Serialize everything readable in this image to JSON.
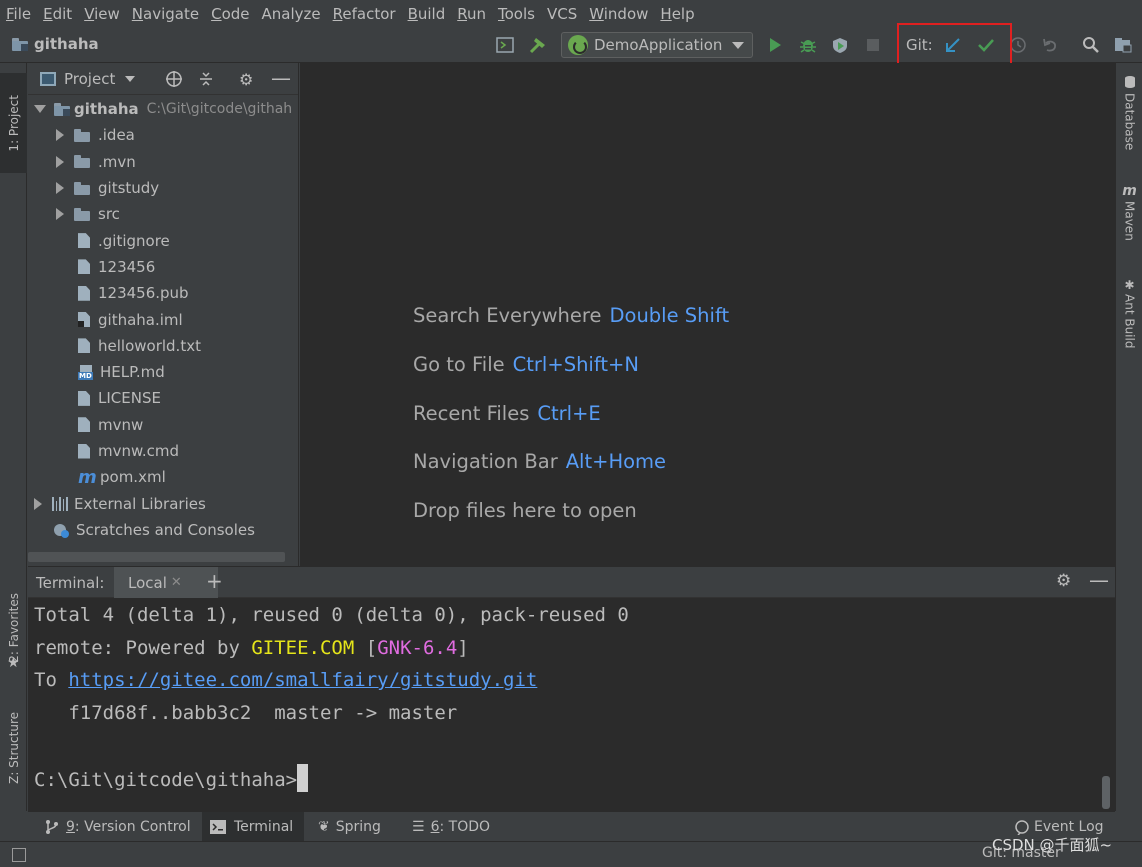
{
  "menu": {
    "items": [
      {
        "u": "F",
        "rest": "ile"
      },
      {
        "u": "E",
        "rest": "dit"
      },
      {
        "u": "V",
        "rest": "iew"
      },
      {
        "u": "N",
        "rest": "avigate"
      },
      {
        "u": "C",
        "rest": "ode"
      },
      {
        "u": "",
        "rest": "Analyze"
      },
      {
        "u": "R",
        "rest": "efactor"
      },
      {
        "u": "B",
        "rest": "uild"
      },
      {
        "u": "R",
        "rest": "un"
      },
      {
        "u": "T",
        "rest": "ools"
      },
      {
        "u": "",
        "rest": "VCS"
      },
      {
        "u": "W",
        "rest": "indow"
      },
      {
        "u": "H",
        "rest": "elp"
      }
    ]
  },
  "navbar": {
    "project_name": "githaha",
    "run_config": "DemoApplication",
    "git_label": "Git:"
  },
  "left_strip": {
    "project_tab": "1: Project",
    "favorites_tab": "2: Favorites",
    "structure_tab": "Z: Structure"
  },
  "right_strip": {
    "database_tab": "Database",
    "maven_tab": "Maven",
    "ant_tab": "Ant Build"
  },
  "project_panel": {
    "title": "Project",
    "root": {
      "name": "githaha",
      "path": "C:\\Git\\gitcode\\githah"
    },
    "folders": [
      ".idea",
      ".mvn",
      "gitstudy",
      "src"
    ],
    "files": [
      ".gitignore",
      "123456",
      "123456.pub",
      "githaha.iml",
      "helloworld.txt",
      "HELP.md",
      "LICENSE",
      "mvnw",
      "mvnw.cmd",
      "pom.xml"
    ],
    "external_libraries": "External Libraries",
    "scratches": "Scratches and Consoles"
  },
  "editor_hints": [
    {
      "text": "Search Everywhere",
      "key": "Double Shift"
    },
    {
      "text": "Go to File",
      "key": "Ctrl+Shift+N"
    },
    {
      "text": "Recent Files",
      "key": "Ctrl+E"
    },
    {
      "text": "Navigation Bar",
      "key": "Alt+Home"
    },
    {
      "text": "Drop files here to open",
      "key": ""
    }
  ],
  "terminal": {
    "title": "Terminal:",
    "tab_label": "Local",
    "line1": "Total 4 (delta 1), reused 0 (delta 0), pack-reused 0",
    "line2_pre": "remote: Powered by ",
    "line2_gitee": "GITEE.COM",
    "line2_mid": " [",
    "line2_gnk": "GNK-6.4",
    "line2_end": "]",
    "line3_pre": "To ",
    "line3_url": "https://gitee.com/smallfairy/gitstudy.git",
    "line4": "   f17d68f..babb3c2  master -> master",
    "prompt": "C:\\Git\\gitcode\\githaha>"
  },
  "bottom_tabs": {
    "version_control_u": "9",
    "version_control_rest": ": Version Control",
    "terminal": "Terminal",
    "spring": "Spring",
    "todo_u": "6",
    "todo_rest": ": TODO",
    "event_log": "Event Log"
  },
  "status": {
    "branch": "Git: master",
    "watermark": "CSDN @千面狐~"
  }
}
